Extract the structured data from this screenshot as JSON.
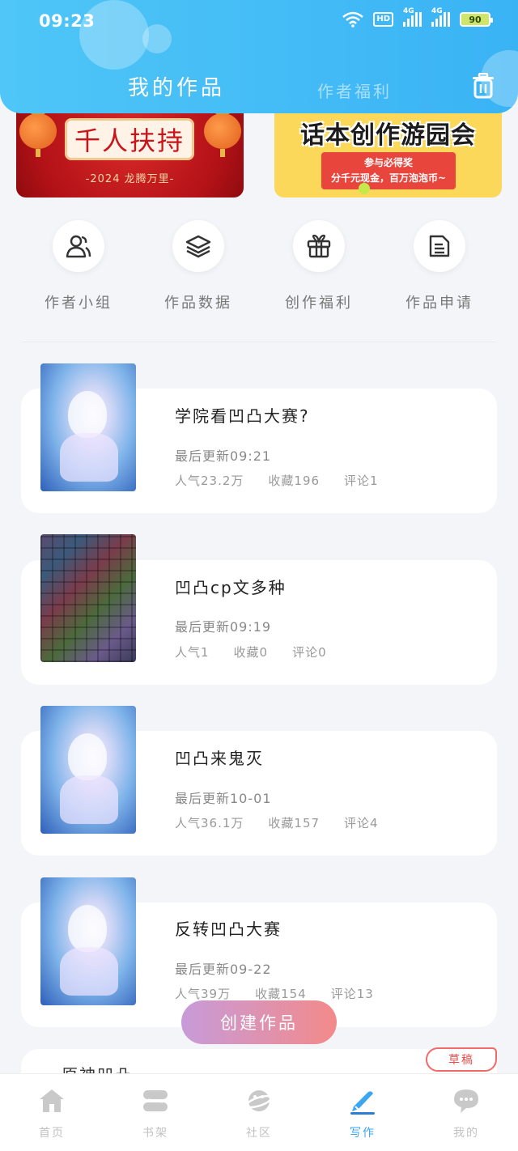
{
  "status_bar": {
    "time": "09:23",
    "hd": "HD",
    "net1": "4G",
    "net2": "4G",
    "battery": "90"
  },
  "header": {
    "tab_mine": "我的作品",
    "tab_welfare": "作者福利",
    "trash_icon": "trash-icon"
  },
  "banners": [
    {
      "title": "千人扶持",
      "subtitle": "-2024 龙腾万里-"
    },
    {
      "title": "话本创作游园会",
      "line1": "参与必得奖",
      "line2": "分千元现金，百万泡泡币~"
    }
  ],
  "actions": [
    {
      "label": "作者小组",
      "icon": "users-icon"
    },
    {
      "label": "作品数据",
      "icon": "layers-icon"
    },
    {
      "label": "创作福利",
      "icon": "gift-icon"
    },
    {
      "label": "作品申请",
      "icon": "document-icon"
    }
  ],
  "works": [
    {
      "title": "学院看凹凸大赛?",
      "updated": "最后更新09:21",
      "popularity": "人气23.2万",
      "favorites": "收藏196",
      "comments": "评论1"
    },
    {
      "title": "凹凸cp文多种",
      "updated": "最后更新09:19",
      "popularity": "人气1",
      "favorites": "收藏0",
      "comments": "评论0"
    },
    {
      "title": "凹凸来鬼灭",
      "updated": "最后更新10-01",
      "popularity": "人气36.1万",
      "favorites": "收藏157",
      "comments": "评论4"
    },
    {
      "title": "反转凹凸大赛",
      "updated": "最后更新09-22",
      "popularity": "人气39万",
      "favorites": "收藏154",
      "comments": "评论13"
    }
  ],
  "draft": {
    "title": "原神凹凸",
    "badge": "草稿"
  },
  "create_button": "创建作品",
  "bottom_nav": [
    {
      "label": "首页",
      "icon": "home-icon"
    },
    {
      "label": "书架",
      "icon": "bookshelf-icon"
    },
    {
      "label": "社区",
      "icon": "planet-icon"
    },
    {
      "label": "写作",
      "icon": "pen-icon",
      "active": true
    },
    {
      "label": "我的",
      "icon": "chat-bubble-icon"
    }
  ],
  "colors": {
    "header": "#3ab3f5",
    "active_nav": "#3ba6f2",
    "create_start": "#c79bd9",
    "create_end": "#f38a8a",
    "draft_badge": "#e74c4c"
  }
}
